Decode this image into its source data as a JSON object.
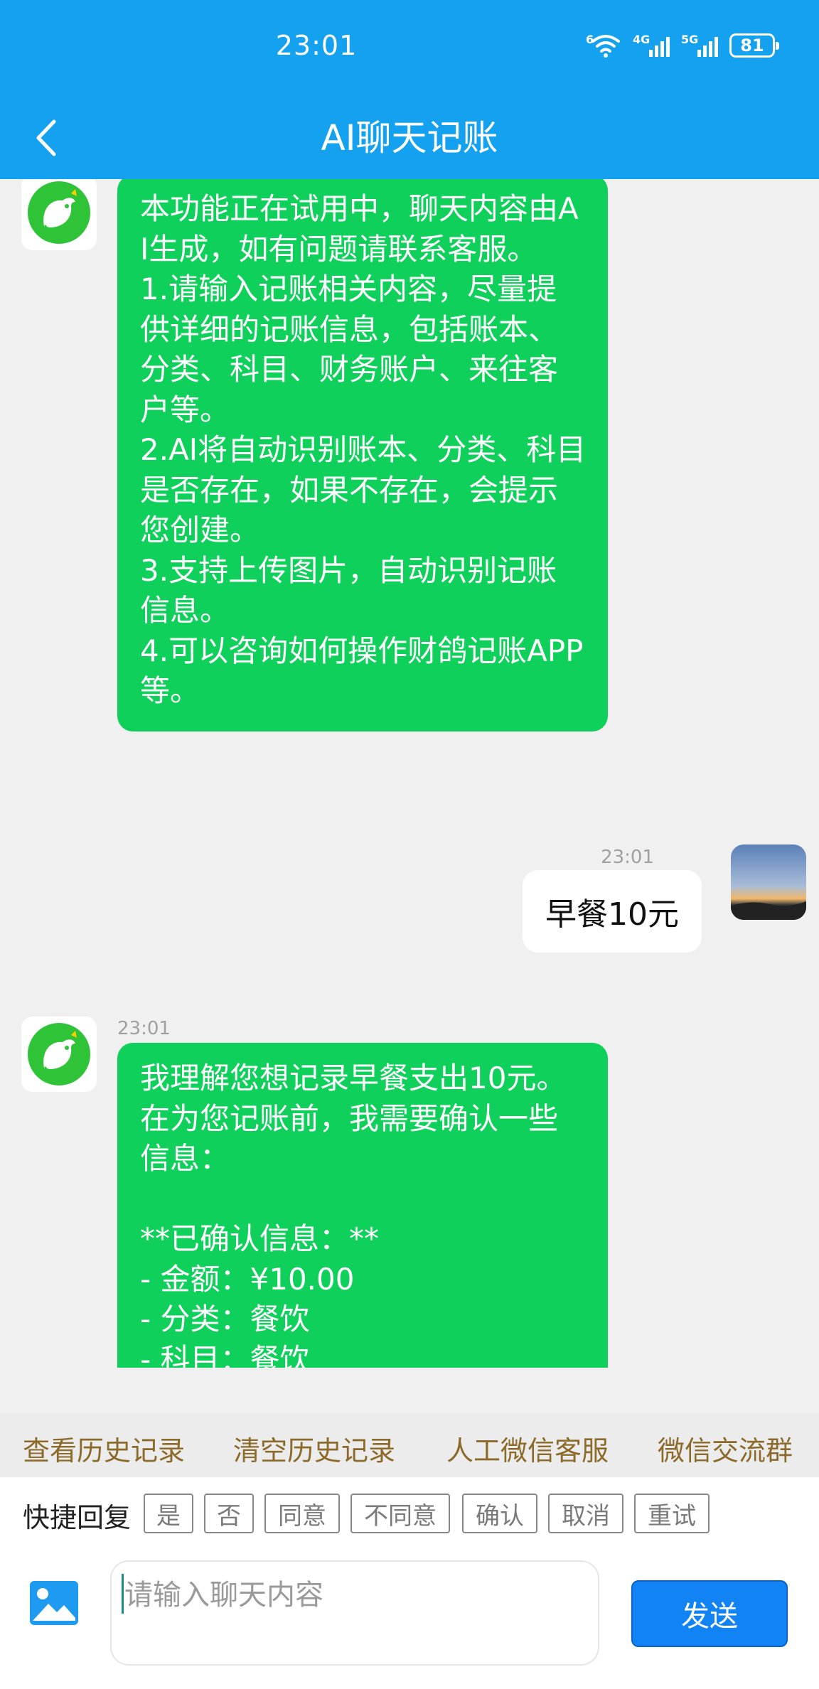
{
  "status_bar": {
    "time": "23:01",
    "wifi_badge": "6",
    "signal1_label": "4G",
    "signal2_label": "5G",
    "battery": "81"
  },
  "header": {
    "title": "AI聊天记账",
    "back_icon": "chevron-left-icon"
  },
  "messages": {
    "bot_intro": {
      "text": "本功能正在试用中，聊天内容由AI生成，如有问题请联系客服。\n1.请输入记账相关内容，尽量提供详细的记账信息，包括账本、分类、科目、财务账户、来往客户等。\n2.AI将自动识别账本、分类、科目是否存在，如果不存在，会提示您创建。\n3.支持上传图片，自动识别记账信息。\n4.可以咨询如何操作财鸽记账APP等。"
    },
    "user_msg": {
      "time": "23:01",
      "text": "早餐10元"
    },
    "bot_reply": {
      "time": "23:01",
      "text": "我理解您想记录早餐支出10元。在为您记账前，我需要确认一些信息：\n\n**已确认信息：**\n- 金额：¥10.00\n- 分类：餐饮\n- 科目：餐饮"
    }
  },
  "actions": [
    "查看历史记录",
    "清空历史记录",
    "人工微信客服",
    "微信交流群"
  ],
  "quick_reply": {
    "label": "快捷回复",
    "options": [
      "是",
      "否",
      "同意",
      "不同意",
      "确认",
      "取消",
      "重试"
    ]
  },
  "input": {
    "placeholder": "请输入聊天内容",
    "value": "",
    "send_label": "发送",
    "image_icon": "image-icon"
  },
  "colors": {
    "header": "#14a1ef",
    "bot_bubble": "#0fd05a",
    "send_button": "#1283f4",
    "action_text": "#8b6a2a"
  }
}
